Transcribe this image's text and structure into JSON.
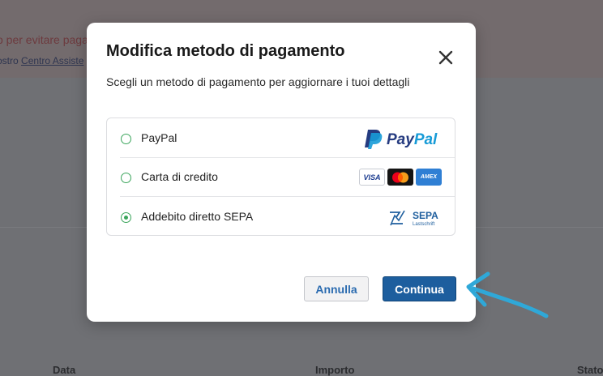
{
  "background": {
    "banner_text_1": "o per evitare paga",
    "banner_text_2_prefix": "ostro",
    "banner_link": "Centro Assiste",
    "columns": [
      "Data",
      "Importo",
      "Stato"
    ]
  },
  "modal": {
    "title": "Modifica metodo di pagamento",
    "subtitle": "Scegli un metodo di pagamento per aggiornare i tuoi dettagli",
    "close_icon": "close-icon",
    "options": [
      {
        "label": "PayPal",
        "selected": false,
        "logo": "paypal-logo"
      },
      {
        "label": "Carta di credito",
        "selected": false,
        "logo": "card-logos"
      },
      {
        "label": "Addebito diretto SEPA",
        "selected": true,
        "logo": "sepa-logo"
      }
    ],
    "paypal_logo_text": "PayPal",
    "card_logos": {
      "visa": "VISA",
      "amex": "AMEX"
    },
    "sepa_logo": {
      "title": "SEPA",
      "sub": "Lastschrift"
    },
    "cancel_label": "Annulla",
    "continue_label": "Continua"
  },
  "colors": {
    "radio": "#3aa55b",
    "primary_button": "#1d5e9e",
    "arrow": "#2fa8d8"
  }
}
